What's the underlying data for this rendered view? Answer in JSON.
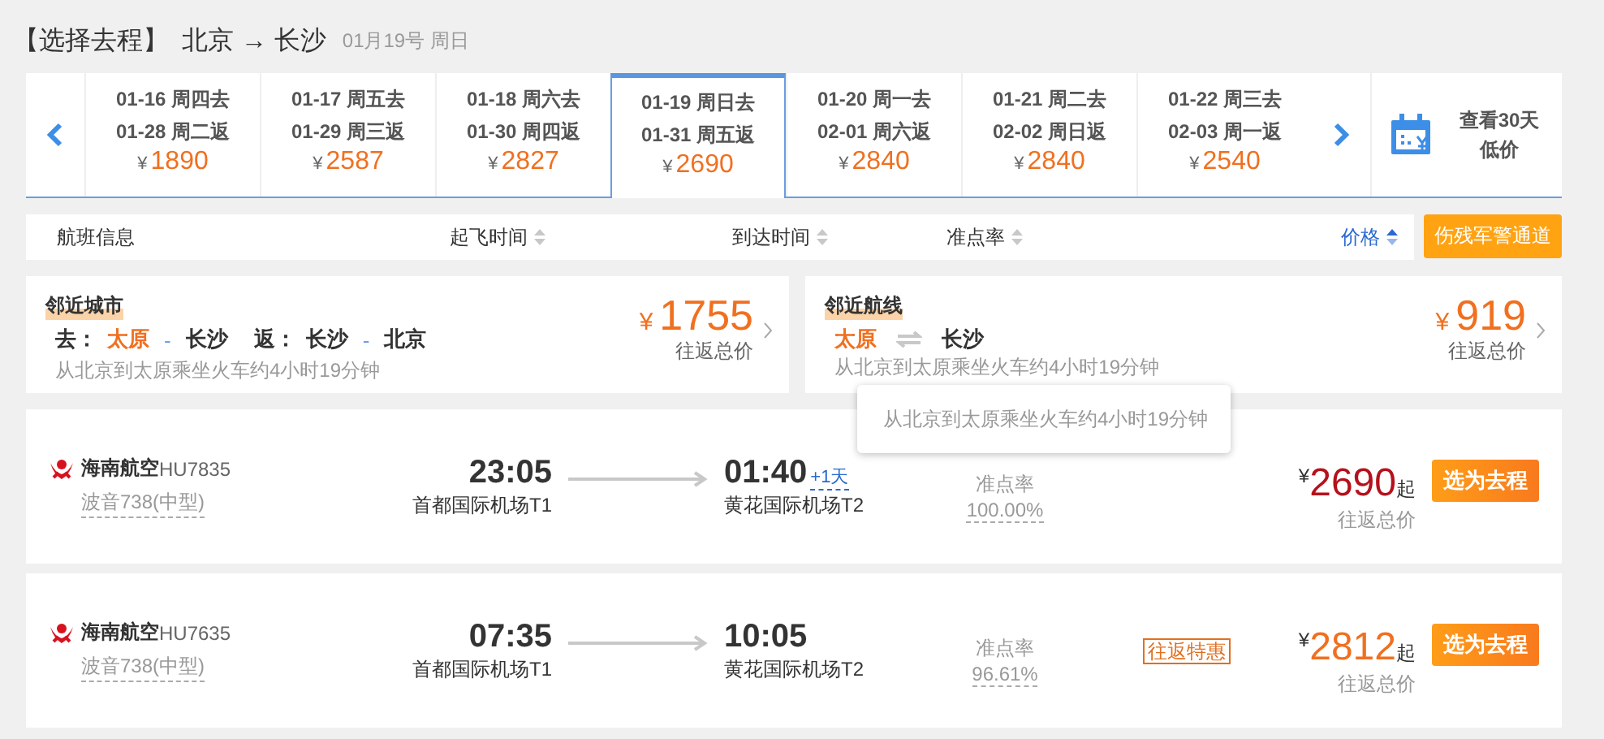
{
  "header": {
    "title": "【选择去程】",
    "route": "北京 → 长沙",
    "date": "01月19号 周日"
  },
  "date_tabs": [
    {
      "depart": "01-16 周四去",
      "return": "01-28 周二返",
      "currency": "¥",
      "price": "1890",
      "selected": false
    },
    {
      "depart": "01-17 周五去",
      "return": "01-29 周三返",
      "currency": "¥",
      "price": "2587",
      "selected": false
    },
    {
      "depart": "01-18 周六去",
      "return": "01-30 周四返",
      "currency": "¥",
      "price": "2827",
      "selected": false
    },
    {
      "depart": "01-19 周日去",
      "return": "01-31 周五返",
      "currency": "¥",
      "price": "2690",
      "selected": true
    },
    {
      "depart": "01-20 周一去",
      "return": "02-01 周六返",
      "currency": "¥",
      "price": "2840",
      "selected": false
    },
    {
      "depart": "01-21 周二去",
      "return": "02-02 周日返",
      "currency": "¥",
      "price": "2840",
      "selected": false
    },
    {
      "depart": "01-22 周三去",
      "return": "02-03 周一返",
      "currency": "¥",
      "price": "2540",
      "selected": false
    }
  ],
  "calendar_link": "查看30天低价",
  "sort_columns": [
    {
      "label": "航班信息",
      "sortable": false,
      "selected": false
    },
    {
      "label": "起飞时间",
      "sortable": true,
      "selected": false
    },
    {
      "label": "到达时间",
      "sortable": true,
      "selected": false
    },
    {
      "label": "准点率",
      "sortable": true,
      "selected": false
    },
    {
      "label": "价格",
      "sortable": true,
      "selected": true
    }
  ],
  "accessible_button": "伤残军警通道",
  "nearby": [
    {
      "kind": "city",
      "title": "邻近城市",
      "parts": [
        {
          "text": "去：",
          "kind": "label"
        },
        {
          "text": "太原",
          "kind": "highlight"
        },
        {
          "text": "-",
          "kind": "dash"
        },
        {
          "text": "长沙",
          "kind": "city"
        },
        {
          "text": "返：",
          "kind": "label"
        },
        {
          "text": "长沙",
          "kind": "city"
        },
        {
          "text": "-",
          "kind": "dash"
        },
        {
          "text": "北京",
          "kind": "city"
        }
      ],
      "note": "从北京到太原乘坐火车约4小时19分钟",
      "currency": "¥",
      "price": "1755",
      "price_note": "往返总价"
    },
    {
      "kind": "route",
      "title": "邻近航线",
      "parts": [
        {
          "text": "太原",
          "kind": "highlight"
        },
        {
          "kind": "swap"
        },
        {
          "text": "长沙",
          "kind": "city"
        }
      ],
      "note": "从北京到太原乘坐火车约4小时19分钟",
      "currency": "¥",
      "price": "919",
      "price_note": "往返总价"
    }
  ],
  "tooltip": "从北京到太原乘坐火车约4小时19分钟",
  "flights": [
    {
      "airline": "海南航空",
      "flight_no": "HU7835",
      "aircraft": "波音738(中型)",
      "dep_time": "23:05",
      "dep_airport": "首都国际机场T1",
      "arr_time": "01:40",
      "arr_day": "+1天",
      "arr_airport": "黄花国际机场T2",
      "ontime_label": "准点率",
      "ontime": "100.00%",
      "currency": "¥",
      "price": "2690",
      "price_suffix": "起",
      "price_note": "往返总价",
      "lowest": true,
      "button": "选为去程"
    },
    {
      "airline": "海南航空",
      "flight_no": "HU7635",
      "aircraft": "波音738(中型)",
      "dep_time": "07:35",
      "dep_airport": "首都国际机场T1",
      "arr_time": "10:05",
      "arr_airport": "黄花国际机场T2",
      "ontime_label": "准点率",
      "ontime": "96.61%",
      "tag": "往返特惠",
      "currency": "¥",
      "price": "2812",
      "price_suffix": "起",
      "price_note": "往返总价",
      "lowest": false,
      "button": "选为去程"
    }
  ]
}
